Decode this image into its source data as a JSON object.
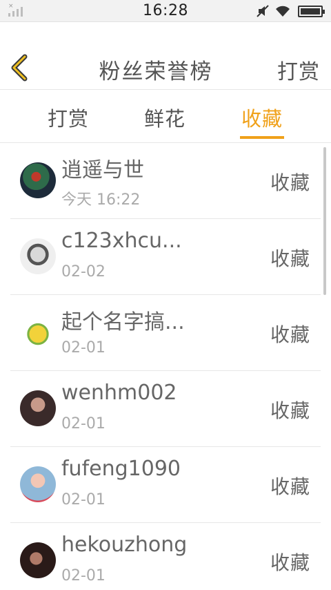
{
  "status_bar": {
    "time": "16:28",
    "icons": [
      "signal-icon",
      "mute-icon",
      "wifi-icon",
      "battery-icon"
    ],
    "signal_mark": "×"
  },
  "header": {
    "back_icon": "chevron-left-icon",
    "title": "粉丝荣誉榜",
    "right_action": "打赏"
  },
  "tabs": [
    {
      "label": "打赏",
      "active": false
    },
    {
      "label": "鲜花",
      "active": false
    },
    {
      "label": "收藏",
      "active": true
    }
  ],
  "accent_color": "#f0a11a",
  "list": {
    "items": [
      {
        "name": "逍遥与世",
        "date": "今天 16:22",
        "action": "收藏"
      },
      {
        "name": "c123xhcu...",
        "date": "02-02",
        "action": "收藏"
      },
      {
        "name": "起个名字搞...",
        "date": "02-01",
        "action": "收藏"
      },
      {
        "name": "wenhm002",
        "date": "02-01",
        "action": "收藏"
      },
      {
        "name": "fufeng1090",
        "date": "02-01",
        "action": "收藏"
      },
      {
        "name": "hekouzhong",
        "date": "02-01",
        "action": "收藏"
      }
    ]
  }
}
